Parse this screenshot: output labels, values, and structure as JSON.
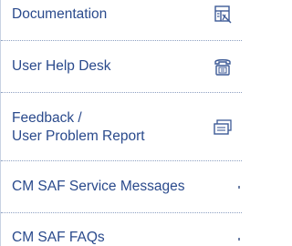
{
  "menu": {
    "items": [
      {
        "label": "Documentation",
        "icon": "document-stack-icon"
      },
      {
        "label": "User Help Desk",
        "icon": "telephone-icon"
      },
      {
        "label_line1": "Feedback /",
        "label_line2": "User Problem Report",
        "icon": "message-window-icon"
      },
      {
        "label": "CM SAF Service Messages"
      },
      {
        "label": "CM SAF FAQs"
      }
    ]
  },
  "colors": {
    "text": "#2a4a8c",
    "divider": "#8ea0c2",
    "icon": "#3d5a96"
  }
}
